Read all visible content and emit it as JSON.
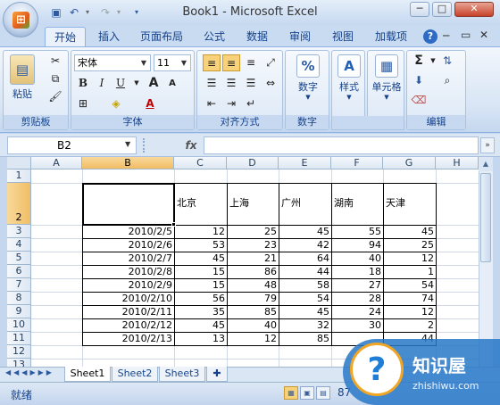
{
  "window": {
    "title": "Book1 - Microsoft Excel"
  },
  "quick_access": [
    "save-icon",
    "undo-icon",
    "redo-icon",
    "customize-icon"
  ],
  "window_buttons": {
    "minimize": "─",
    "restore": "□",
    "close": "✕"
  },
  "ribbon_tabs": [
    "开始",
    "插入",
    "页面布局",
    "公式",
    "数据",
    "审阅",
    "视图",
    "加载项"
  ],
  "ribbon_tab_active": "开始",
  "ribbon": {
    "clipboard": {
      "label": "剪贴板",
      "paste": "粘贴"
    },
    "font": {
      "label": "字体",
      "name": "宋体",
      "size": "11",
      "bold": "B",
      "italic": "I",
      "underline": "U",
      "grow": "A",
      "shrink": "A",
      "font_color": "A"
    },
    "alignment": {
      "label": "对齐方式"
    },
    "number": {
      "label": "数字",
      "icon": "%"
    },
    "styles": {
      "label": "样式"
    },
    "cells": {
      "label": "单元格"
    },
    "editing": {
      "label": "编辑",
      "sum": "Σ"
    }
  },
  "formula_bar": {
    "name_box": "B2",
    "fx": "fx",
    "formula": ""
  },
  "columns": [
    "A",
    "B",
    "C",
    "D",
    "E",
    "F",
    "G",
    "H"
  ],
  "rows": [
    "1",
    "2",
    "3",
    "4",
    "5",
    "6",
    "7",
    "8",
    "9",
    "10",
    "11",
    "12",
    "13"
  ],
  "table": {
    "headers": [
      "北京",
      "上海",
      "广州",
      "湖南",
      "天津"
    ],
    "rows": [
      {
        "date": "2010/2/5",
        "values": [
          "12",
          "25",
          "45",
          "55",
          "45"
        ]
      },
      {
        "date": "2010/2/6",
        "values": [
          "53",
          "23",
          "42",
          "94",
          "25"
        ]
      },
      {
        "date": "2010/2/7",
        "values": [
          "45",
          "21",
          "64",
          "40",
          "12"
        ]
      },
      {
        "date": "2010/2/8",
        "values": [
          "15",
          "86",
          "44",
          "18",
          "1"
        ]
      },
      {
        "date": "2010/2/9",
        "values": [
          "15",
          "48",
          "58",
          "27",
          "54"
        ]
      },
      {
        "date": "2010/2/10",
        "values": [
          "56",
          "79",
          "54",
          "28",
          "74"
        ]
      },
      {
        "date": "2010/2/11",
        "values": [
          "35",
          "85",
          "45",
          "24",
          "12"
        ]
      },
      {
        "date": "2010/2/12",
        "values": [
          "45",
          "40",
          "32",
          "30",
          "2"
        ]
      },
      {
        "date": "2010/2/13",
        "values": [
          "13",
          "12",
          "85",
          "52",
          "44"
        ]
      }
    ]
  },
  "sheet_tabs": [
    "Sheet1",
    "Sheet2",
    "Sheet3"
  ],
  "active_sheet": "Sheet1",
  "status": {
    "text": "就绪",
    "zoom": "87"
  },
  "watermark": {
    "title": "知识屋",
    "url": "zhishiwu.com"
  }
}
